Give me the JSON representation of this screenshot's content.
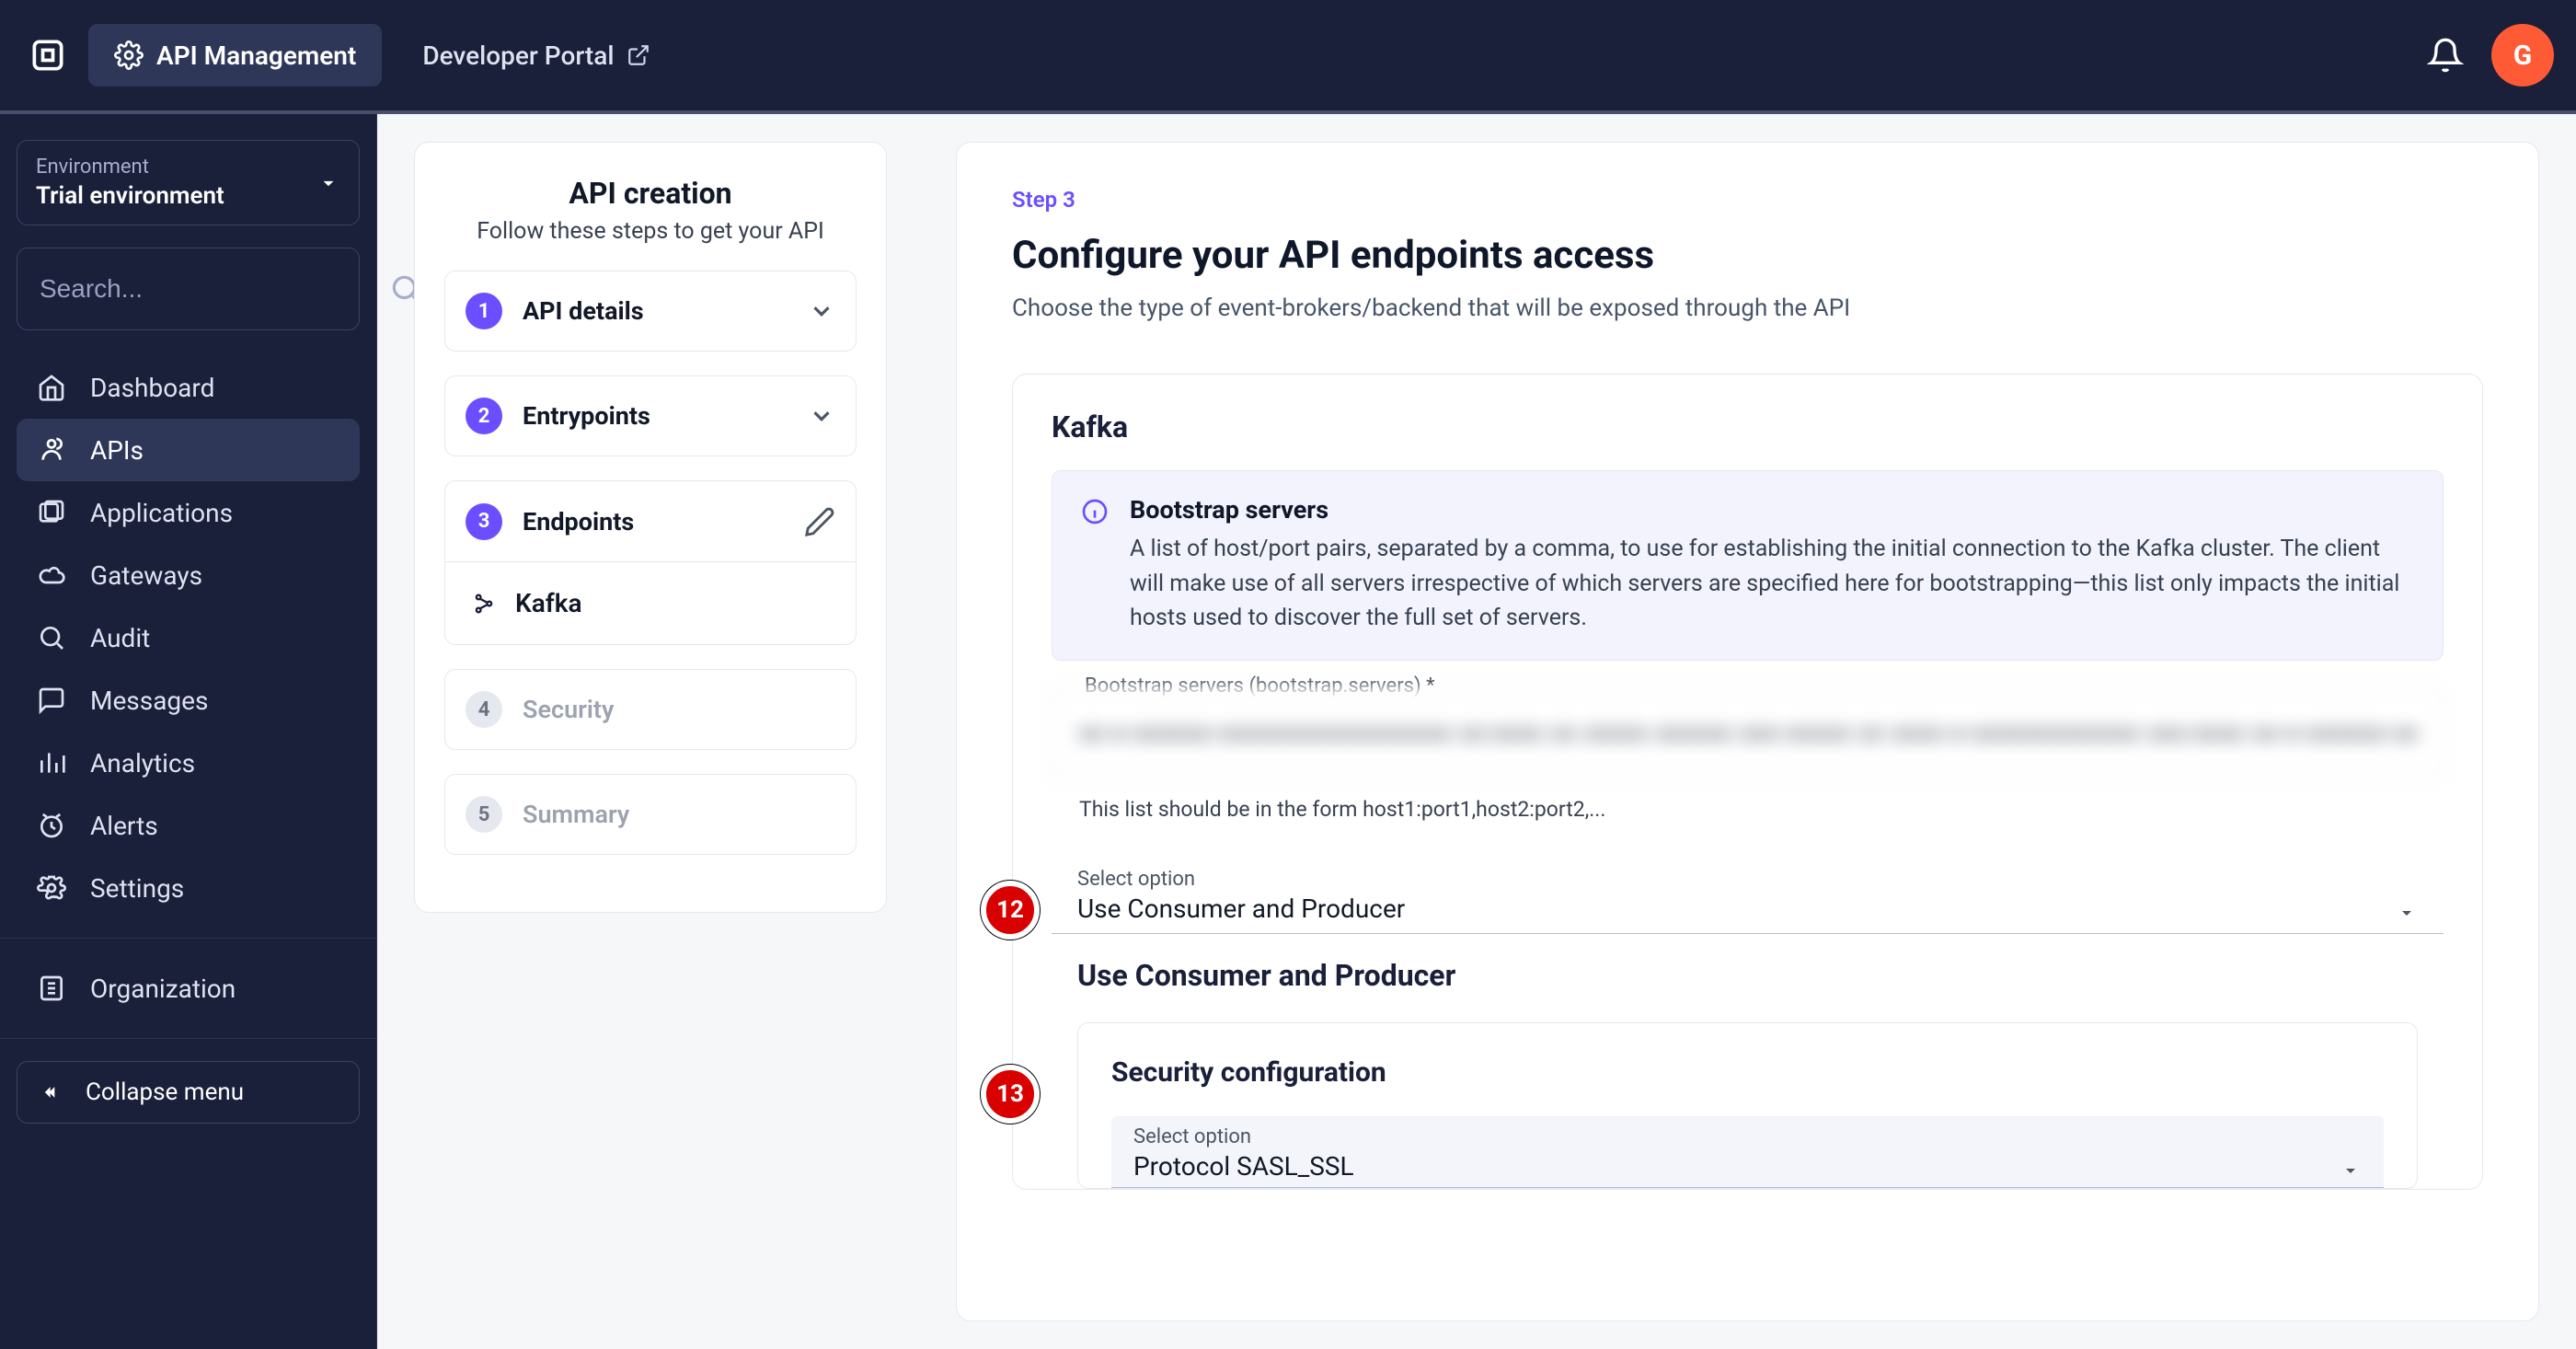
{
  "topbar": {
    "nav": {
      "api_mgmt": "API Management",
      "dev_portal": "Developer Portal"
    },
    "avatar_initial": "G"
  },
  "sidebar": {
    "env": {
      "label": "Environment",
      "value": "Trial environment"
    },
    "search_placeholder": "Search...",
    "items": [
      {
        "label": "Dashboard"
      },
      {
        "label": "APIs"
      },
      {
        "label": "Applications"
      },
      {
        "label": "Gateways"
      },
      {
        "label": "Audit"
      },
      {
        "label": "Messages"
      },
      {
        "label": "Analytics"
      },
      {
        "label": "Alerts"
      },
      {
        "label": "Settings"
      }
    ],
    "organization": "Organization",
    "collapse": "Collapse menu"
  },
  "stepper": {
    "title": "API creation",
    "subtitle": "Follow these steps to get your API",
    "steps": [
      {
        "n": "1",
        "label": "API details"
      },
      {
        "n": "2",
        "label": "Entrypoints"
      },
      {
        "n": "3",
        "label": "Endpoints",
        "sub": "Kafka"
      },
      {
        "n": "4",
        "label": "Security"
      },
      {
        "n": "5",
        "label": "Summary"
      }
    ]
  },
  "content": {
    "step_chip": "Step 3",
    "title": "Configure your API endpoints access",
    "subtitle": "Choose the type of event-brokers/backend that will be exposed through the API",
    "kafka": {
      "heading": "Kafka",
      "info_title": "Bootstrap servers",
      "info_desc": "A list of host/port pairs, separated by a comma, to use for establishing the initial connection to the Kafka cluster. The client will make use of all servers irrespective of which servers are specified here for bootstrapping—this list only impacts the initial hosts used to discover the full set of servers.",
      "input_label": "Bootstrap servers (bootstrap.servers)",
      "input_required": "*",
      "input_value": "xx-x-xxxxxx-xxxxxxxxxxxxxxxxxx xx:xxxx xx xxxxx xxxxxx xxx-xxxxx xx xxxx-x-xxxxxxxxxxxxx xxx:xxxx xx-x-xxxxxx-xxxxxxxxxxxxxxxxxx",
      "helper": "This list should be in the form host1:port1,host2:port2,...",
      "select_label": "Select option",
      "select_value": "Use Consumer and Producer",
      "second_heading": "Use Consumer and Producer",
      "security_heading": "Security configuration",
      "proto_label": "Select option",
      "proto_value": "Protocol SASL_SSL"
    }
  },
  "badges": {
    "b12": "12",
    "b13": "13"
  }
}
